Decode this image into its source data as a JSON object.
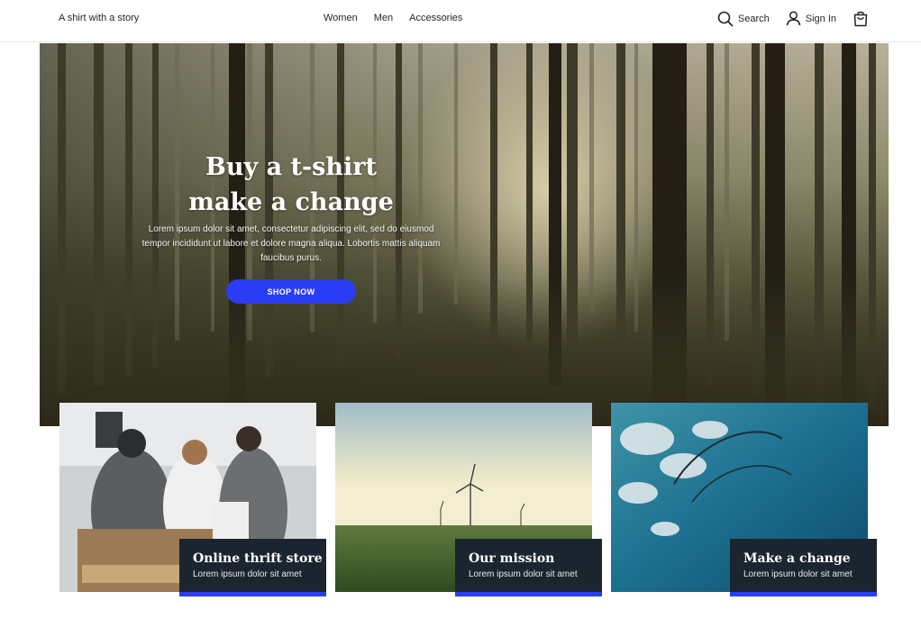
{
  "header": {
    "brand": "A shirt with a story",
    "nav": [
      {
        "label": "Women"
      },
      {
        "label": "Men"
      },
      {
        "label": "Accessories"
      }
    ],
    "search_label": "Search",
    "signin_label": "Sign In",
    "cart_icon": "shopping-bag-icon"
  },
  "hero": {
    "title_line1": "Buy a t-shirt",
    "title_line2": "make a change",
    "body": "Lorem ipsum dolor sit amet, consectetur adipiscing elit, sed do eiusmod tempor incididunt ut labore et dolore magna aliqua. Lobortis mattis aliquam faucibus purus.",
    "cta_label": "SHOP NOW",
    "cta_color": "#2a3df5"
  },
  "cards": [
    {
      "title": "Online thrift store",
      "subtitle": "Lorem ipsum dolor sit amet"
    },
    {
      "title": "Our mission",
      "subtitle": "Lorem ipsum dolor sit amet"
    },
    {
      "title": "Make a change",
      "subtitle": "Lorem ipsum dolor sit amet"
    }
  ],
  "colors": {
    "accent": "#2a3df5",
    "overlay_bg": "#1b2530"
  }
}
